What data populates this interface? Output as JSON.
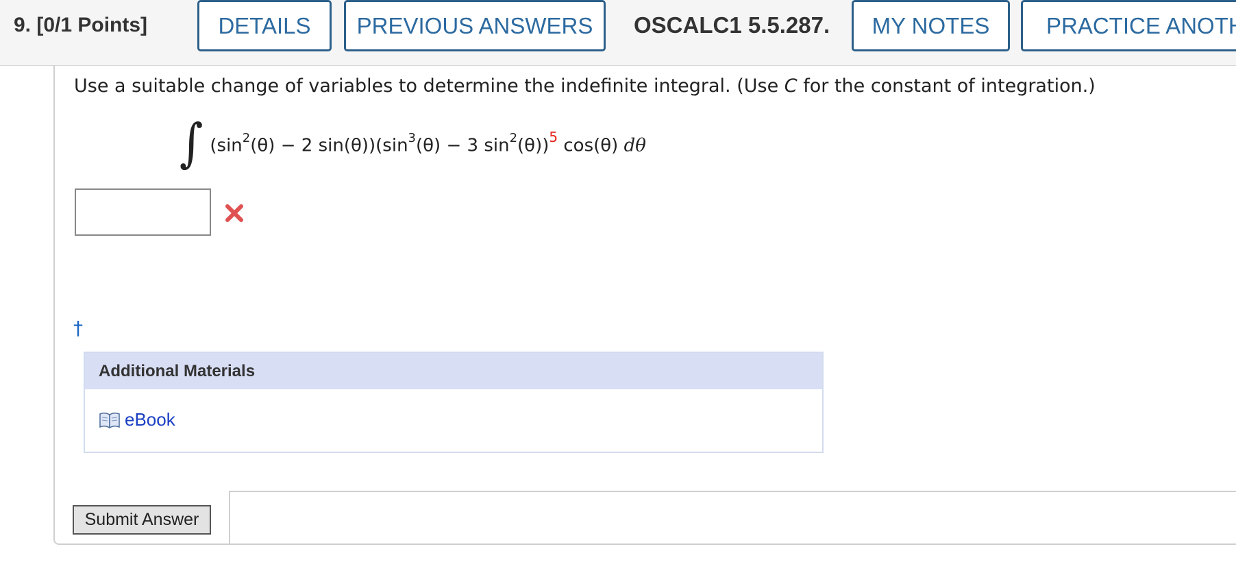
{
  "header": {
    "question_label": "9.  [0/1 Points]",
    "buttons": {
      "details": "DETAILS",
      "previous_answers": "PREVIOUS ANSWERS",
      "my_notes": "MY NOTES",
      "practice_another": "PRACTICE ANOTHER"
    },
    "course_code": "OSCALC1 5.5.287."
  },
  "question": {
    "prompt_before": "Use a suitable change of variables to determine the indefinite integral. (Use ",
    "prompt_var": "C",
    "prompt_after": " for the constant of integration.)",
    "integral": {
      "sign": "∫",
      "part1": "(sin",
      "exp1": "2",
      "part2": "(θ) − 2 sin(θ))(sin",
      "exp2": "3",
      "part3": "(θ) − 3 sin",
      "exp3": "2",
      "part4": "(θ))",
      "outer_exp": "5",
      "part5": " cos(θ) ",
      "differential": "dθ"
    },
    "answer_value": "",
    "result_icon": "wrong-x-icon",
    "dagger": "†"
  },
  "materials": {
    "title": "Additional Materials",
    "ebook_label": "eBook"
  },
  "submit_label": "Submit Answer",
  "colors": {
    "button_border": "#2c5f8a",
    "button_text": "#2c6aa0",
    "wrong_x": "#e05252",
    "exponent_red": "#e4201a",
    "materials_header": "#d8def4",
    "link_blue": "#1a3fc4"
  }
}
